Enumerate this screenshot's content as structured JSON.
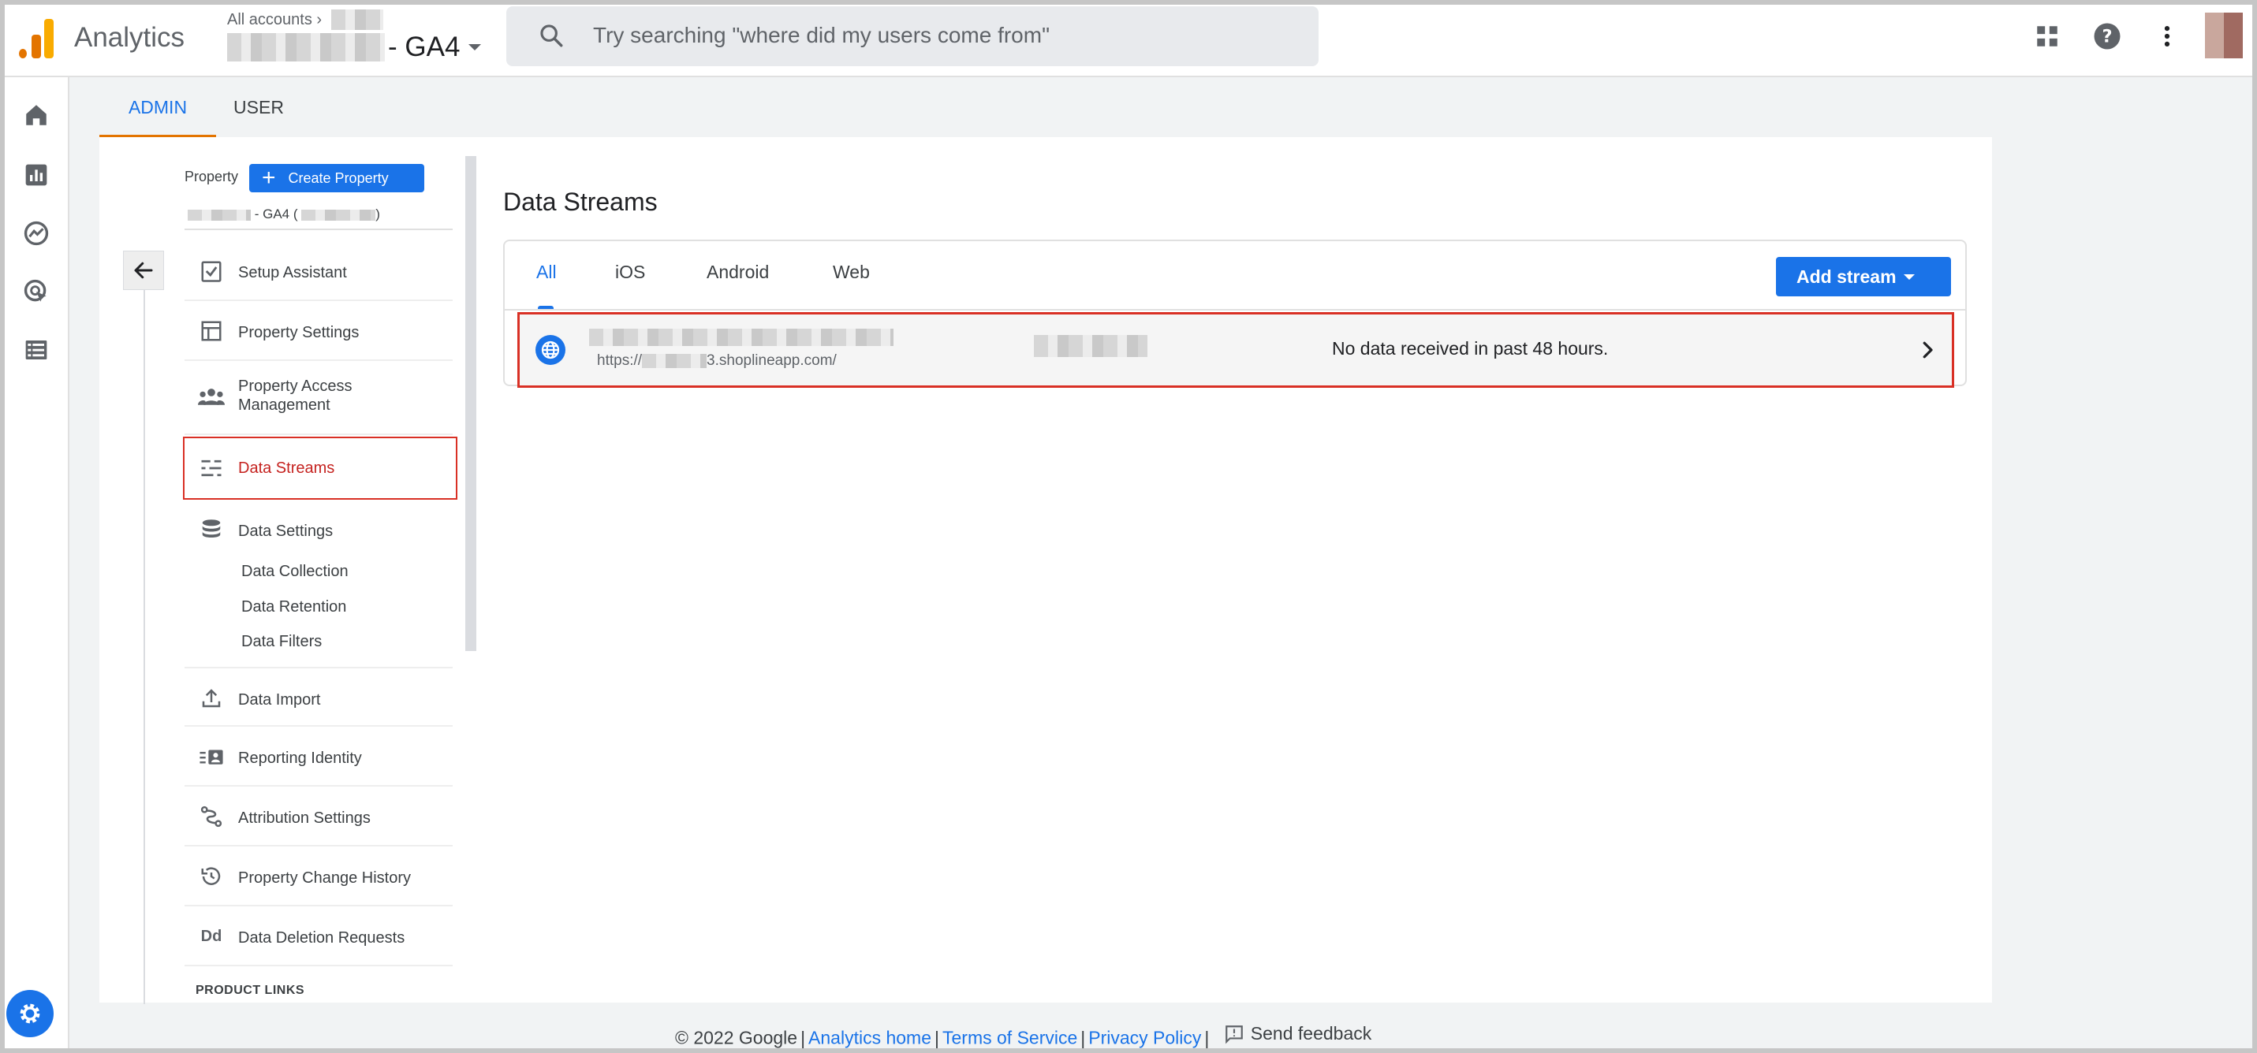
{
  "header": {
    "app_title": "Analytics",
    "accounts_crumb": "All accounts",
    "property_suffix": "- GA4",
    "search_placeholder": "Try searching \"where did my users come from\""
  },
  "tabs": {
    "admin": "ADMIN",
    "user": "USER"
  },
  "admin_nav": {
    "property_label": "Property",
    "create_property": "Create Property",
    "property_value": "- GA4 (",
    "items": [
      {
        "label": "Setup Assistant",
        "icon": "checklist-icon"
      },
      {
        "label": "Property Settings",
        "icon": "property-settings-icon"
      },
      {
        "label": "Property Access Management",
        "icon": "people-icon"
      },
      {
        "label": "Data Streams",
        "icon": "data-streams-icon",
        "active": true
      },
      {
        "label": "Data Settings",
        "icon": "database-icon"
      },
      {
        "label": "Data Import",
        "icon": "upload-icon"
      },
      {
        "label": "Reporting Identity",
        "icon": "reporting-identity-icon"
      },
      {
        "label": "Attribution Settings",
        "icon": "attribution-icon"
      },
      {
        "label": "Property Change History",
        "icon": "history-icon"
      },
      {
        "label": "Data Deletion Requests",
        "icon": "dd-icon"
      }
    ],
    "sub_items": [
      "Data Collection",
      "Data Retention",
      "Data Filters"
    ],
    "product_links": "PRODUCT LINKS"
  },
  "data_streams": {
    "title": "Data Streams",
    "tabs": [
      "All",
      "iOS",
      "Android",
      "Web"
    ],
    "selected_tab": "All",
    "add_stream": "Add stream",
    "stream": {
      "url_prefix": "https://",
      "url_suffix": "3.shoplineapp.com/",
      "status": "No data received in past 48 hours."
    }
  },
  "footer": {
    "copyright": "© 2022 Google",
    "analytics_home": "Analytics home",
    "terms": "Terms of Service",
    "privacy": "Privacy Policy",
    "feedback": "Send feedback"
  },
  "colors": {
    "accent_blue": "#1a73e8",
    "highlight_red": "#d93025",
    "orange": "#e37400"
  }
}
